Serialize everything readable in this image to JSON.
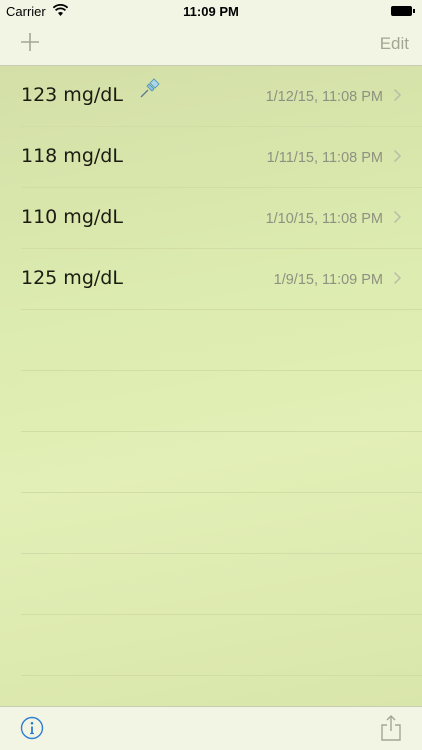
{
  "status_bar": {
    "carrier": "Carrier",
    "time": "11:09 PM",
    "wifi_icon": "wifi-icon",
    "battery_icon": "battery-icon"
  },
  "nav_bar": {
    "add_icon": "plus-icon",
    "edit_label": "Edit"
  },
  "readings": [
    {
      "value": "123 mg/dL",
      "date": "1/12/15, 11:08 PM",
      "pinned": true
    },
    {
      "value": "118 mg/dL",
      "date": "1/11/15, 11:08 PM",
      "pinned": false
    },
    {
      "value": "110 mg/dL",
      "date": "1/10/15, 11:08 PM",
      "pinned": false
    },
    {
      "value": "125 mg/dL",
      "date": "1/9/15, 11:09 PM",
      "pinned": false
    }
  ],
  "tab_bar": {
    "info_icon": "info-icon",
    "share_icon": "share-icon"
  },
  "colors": {
    "bar_background": "#f3f5e4",
    "paper_green": "#dcebaf",
    "rule_line": "#d1dca6",
    "accent_blue": "#2f7dd0",
    "muted_gray": "#a3a692"
  }
}
